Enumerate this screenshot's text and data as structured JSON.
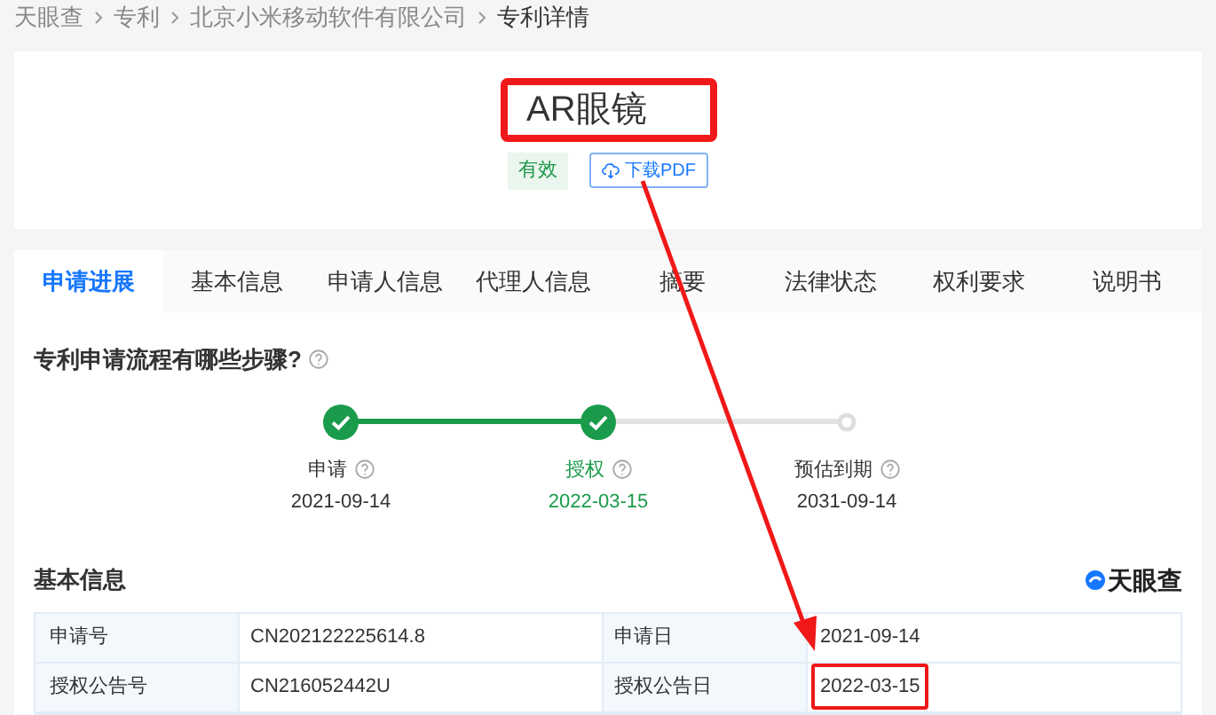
{
  "breadcrumb": [
    {
      "label": "天眼查",
      "current": false
    },
    {
      "label": "专利",
      "current": false
    },
    {
      "label": "北京小米移动软件有限公司",
      "current": false
    },
    {
      "label": "专利详情",
      "current": true
    }
  ],
  "patent": {
    "title": "AR眼镜",
    "status": "有效",
    "download": "下载PDF"
  },
  "tabs": [
    {
      "label": "申请进展",
      "selected": true
    },
    {
      "label": "基本信息",
      "selected": false
    },
    {
      "label": "申请人信息",
      "selected": false
    },
    {
      "label": "代理人信息",
      "selected": false
    },
    {
      "label": "摘要",
      "selected": false
    },
    {
      "label": "法律状态",
      "selected": false
    },
    {
      "label": "权利要求",
      "selected": false
    },
    {
      "label": "说明书",
      "selected": false
    }
  ],
  "process": {
    "title": "专利申请流程有哪些步骤?",
    "steps": [
      {
        "label": "申请",
        "date": "2021-09-14",
        "done": true,
        "current": false
      },
      {
        "label": "授权",
        "date": "2022-03-15",
        "done": true,
        "current": true
      },
      {
        "label": "预估到期",
        "date": "2031-09-14",
        "done": false,
        "current": false
      }
    ]
  },
  "basic_info": {
    "title": "基本信息",
    "brand": "天眼查",
    "rows": [
      {
        "label_1": "申请号",
        "value_1": "CN202122225614.8",
        "label_2": "申请日",
        "value_2": "2021-09-14"
      },
      {
        "label_1": "授权公告号",
        "value_1": "CN216052442U",
        "label_2": "授权公告日",
        "value_2": "2022-03-15"
      }
    ]
  }
}
